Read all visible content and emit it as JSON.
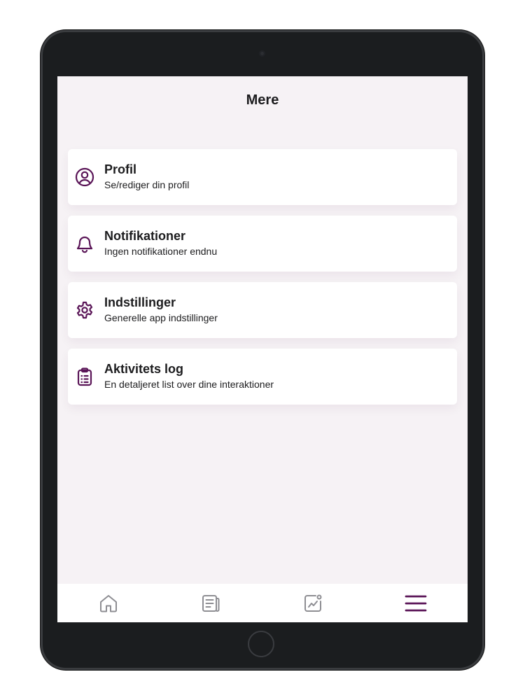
{
  "screen": {
    "title": "Mere"
  },
  "menu": {
    "items": [
      {
        "icon": "user-circle-icon",
        "title": "Profil",
        "subtitle": "Se/rediger din profil"
      },
      {
        "icon": "bell-icon",
        "title": "Notifikationer",
        "subtitle": "Ingen notifikationer endnu"
      },
      {
        "icon": "gear-icon",
        "title": "Indstillinger",
        "subtitle": "Generelle app indstillinger"
      },
      {
        "icon": "clipboard-list-icon",
        "title": "Aktivitets log",
        "subtitle": "En detaljeret list over dine interaktioner"
      }
    ]
  },
  "tab_bar": {
    "tabs": [
      {
        "icon": "home-icon",
        "active": false
      },
      {
        "icon": "news-icon",
        "active": false
      },
      {
        "icon": "chart-icon",
        "active": false
      },
      {
        "icon": "menu-icon",
        "active": true
      }
    ]
  },
  "colors": {
    "accent": "#5a1557",
    "inactive_icon": "#8e8e93",
    "screen_background": "#f6f2f5",
    "card_background": "#ffffff",
    "text": "#1c1c1e",
    "device_frame": "#1b1d1f"
  }
}
